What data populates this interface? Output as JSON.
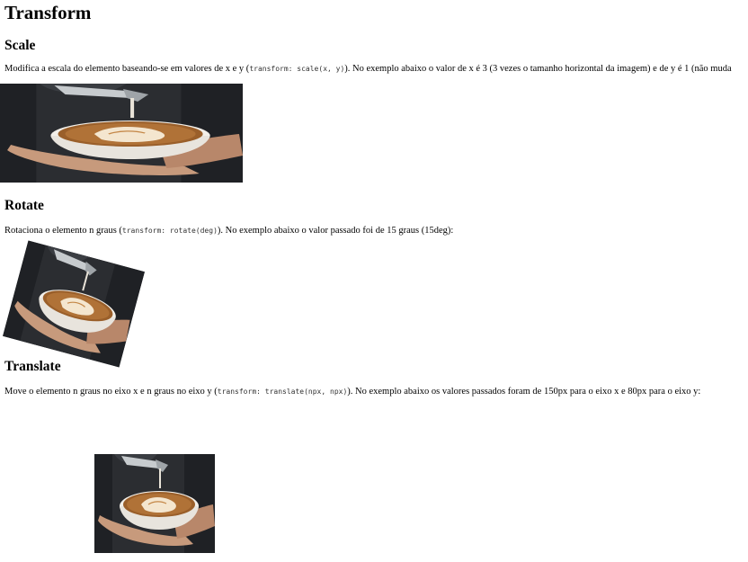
{
  "title": "Transform",
  "sections": {
    "scale": {
      "heading": "Scale",
      "text_before": "Modifica a escala do elemento baseando-se em valores de x e y (",
      "code": "transform: scale(x, y)",
      "text_after": "). No exemplo abaixo o valor de x é 3 (3 vezes o tamanho horizontal da imagem) e de y é 1 (não muda"
    },
    "rotate": {
      "heading": "Rotate",
      "text_before": "Rotaciona o elemento n graus (",
      "code": "transform: rotate(deg)",
      "text_after": "). No exemplo abaixo o valor passado foi de 15 graus (15deg):"
    },
    "translate": {
      "heading": "Translate",
      "text_before": "Move o elemento n graus no eixo x e n graus no eixo y (",
      "code": "transform: translate(npx, npx)",
      "text_after": "). No exemplo abaixo os valores passados foram de 150px para o eixo x e 80px para o eixo y:"
    }
  },
  "image": {
    "subject": "latte-art-pour-photo",
    "colors": {
      "background": "#1f2125",
      "apron": "#2b2d31",
      "cup": "#f2efe9",
      "coffee": "#b07237",
      "foam": "#f4e6cf",
      "skin": "#c79a7c",
      "pitcher": "#bfc3c6"
    }
  }
}
